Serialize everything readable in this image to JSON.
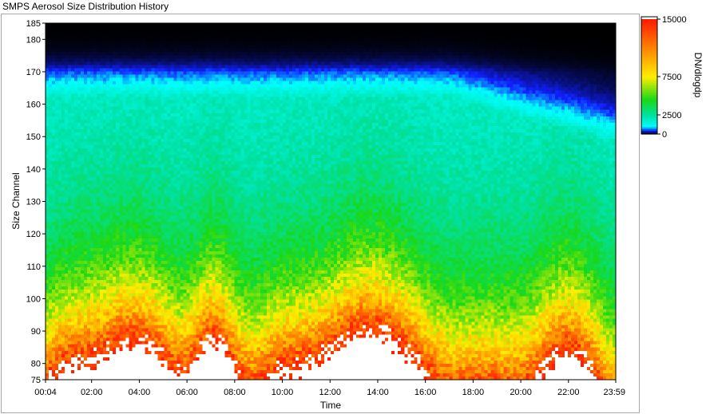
{
  "window": {
    "title": "SMPS Aerosol Size Distribution History"
  },
  "chart_data": {
    "type": "heatmap",
    "title": "",
    "xlabel": "Time",
    "ylabel": "Size Channel",
    "x_ticks": [
      "00:04",
      "02:00",
      "04:00",
      "06:00",
      "08:00",
      "10:00",
      "12:00",
      "14:00",
      "16:00",
      "18:00",
      "20:00",
      "22:00",
      "23:59"
    ],
    "x_range": [
      "00:04",
      "23:59"
    ],
    "y_ticks": [
      75,
      80,
      90,
      100,
      110,
      120,
      130,
      140,
      150,
      160,
      170,
      180,
      185
    ],
    "y_range": [
      75,
      185
    ],
    "colorbar": {
      "label": "DN/dlogdp",
      "ticks": [
        0,
        2500,
        7500,
        15000
      ],
      "tick_labels": [
        "0",
        "2500",
        "7500",
        "15000"
      ],
      "range": [
        0,
        15000
      ],
      "above_range_color": "#ffffff",
      "colormap": [
        {
          "value": 0,
          "color": "#000000"
        },
        {
          "value": 500,
          "color": "#1020ff"
        },
        {
          "value": 1000,
          "color": "#00ffff"
        },
        {
          "value": 2500,
          "color": "#00e0a0"
        },
        {
          "value": 4500,
          "color": "#18d818"
        },
        {
          "value": 7500,
          "color": "#ffee00"
        },
        {
          "value": 11000,
          "color": "#ff8a00"
        },
        {
          "value": 15000,
          "color": "#ff1a00"
        }
      ]
    },
    "grid": false,
    "legend_position": "right"
  }
}
